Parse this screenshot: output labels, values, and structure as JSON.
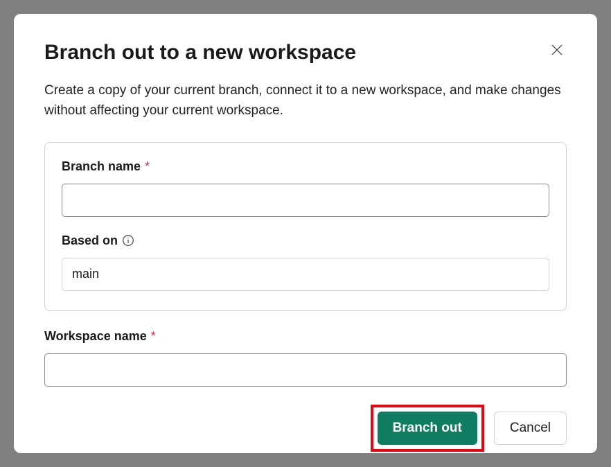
{
  "dialog": {
    "title": "Branch out to a new workspace",
    "description": "Create a copy of your current branch, connect it to a new workspace, and make changes without affecting your current workspace."
  },
  "form": {
    "branch_name": {
      "label": "Branch name",
      "value": ""
    },
    "based_on": {
      "label": "Based on",
      "value": "main"
    },
    "workspace_name": {
      "label": "Workspace name",
      "value": ""
    }
  },
  "buttons": {
    "primary": "Branch out",
    "secondary": "Cancel"
  }
}
